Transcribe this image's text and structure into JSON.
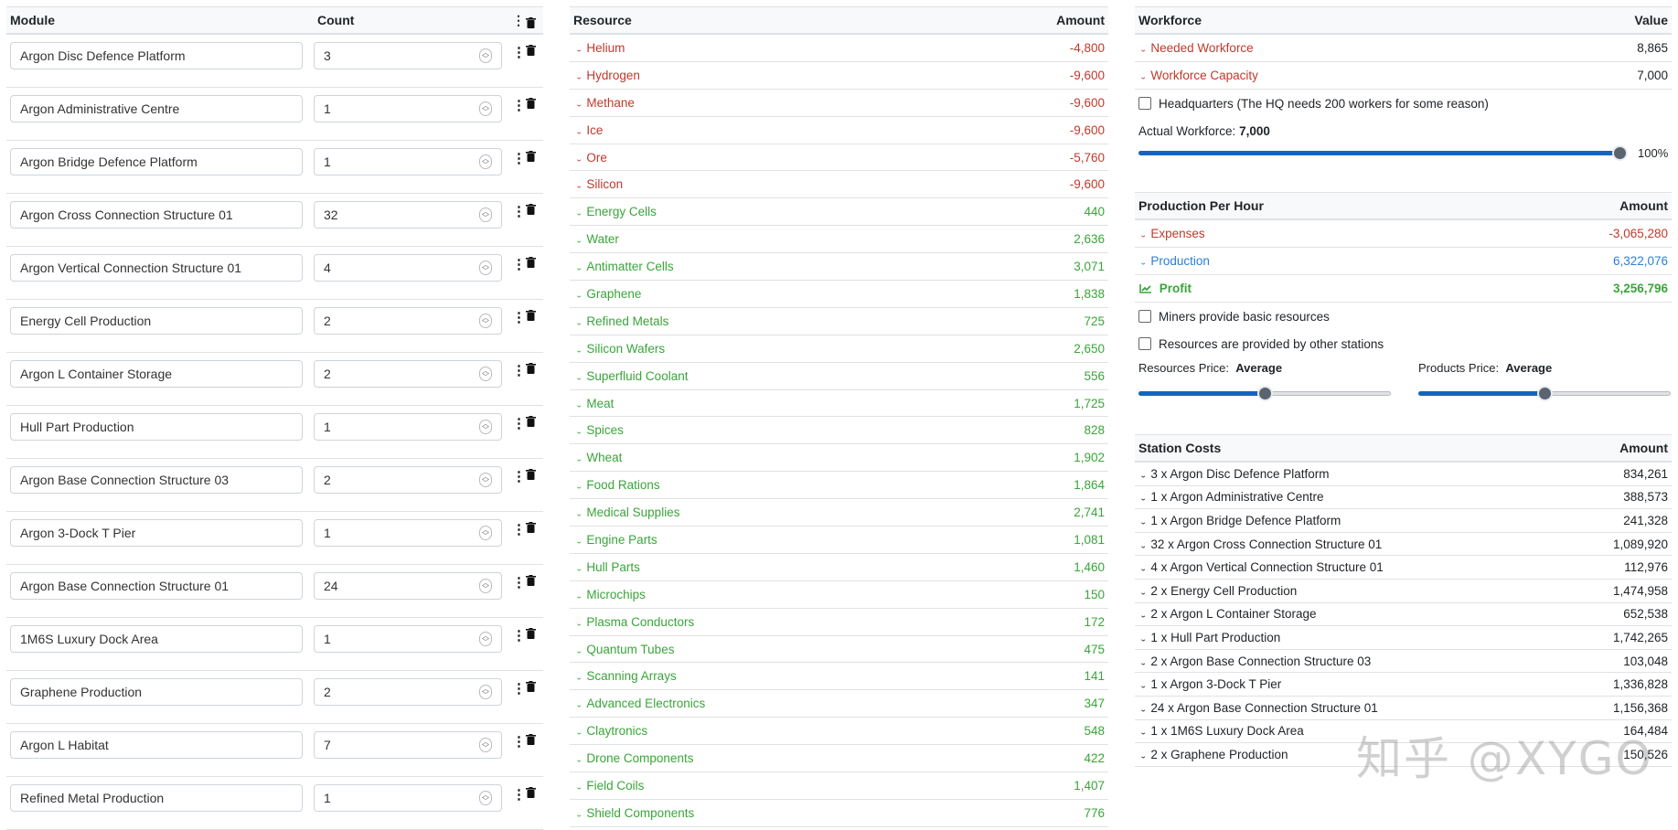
{
  "colors": {
    "negative": "#c0392b",
    "positive": "#3aa53a",
    "production": "#2a7fd4",
    "slider": "#1565c0"
  },
  "modules": {
    "header_module": "Module",
    "header_count": "Count",
    "rows": [
      {
        "name": "Argon Disc Defence Platform",
        "count": "3"
      },
      {
        "name": "Argon Administrative Centre",
        "count": "1"
      },
      {
        "name": "Argon Bridge Defence Platform",
        "count": "1"
      },
      {
        "name": "Argon Cross Connection Structure 01",
        "count": "32"
      },
      {
        "name": "Argon Vertical Connection Structure 01",
        "count": "4"
      },
      {
        "name": "Energy Cell Production",
        "count": "2"
      },
      {
        "name": "Argon L Container Storage",
        "count": "2"
      },
      {
        "name": "Hull Part Production",
        "count": "1"
      },
      {
        "name": "Argon Base Connection Structure 03",
        "count": "2"
      },
      {
        "name": "Argon 3-Dock T Pier",
        "count": "1"
      },
      {
        "name": "Argon Base Connection Structure 01",
        "count": "24"
      },
      {
        "name": "1M6S Luxury Dock Area",
        "count": "1"
      },
      {
        "name": "Graphene Production",
        "count": "2"
      },
      {
        "name": "Argon L Habitat",
        "count": "7"
      },
      {
        "name": "Refined Metal Production",
        "count": "1"
      }
    ]
  },
  "resources": {
    "header_resource": "Resource",
    "header_amount": "Amount",
    "rows": [
      {
        "name": "Helium",
        "amount": "-4,800",
        "kind": "neg"
      },
      {
        "name": "Hydrogen",
        "amount": "-9,600",
        "kind": "neg"
      },
      {
        "name": "Methane",
        "amount": "-9,600",
        "kind": "neg"
      },
      {
        "name": "Ice",
        "amount": "-9,600",
        "kind": "neg"
      },
      {
        "name": "Ore",
        "amount": "-5,760",
        "kind": "neg"
      },
      {
        "name": "Silicon",
        "amount": "-9,600",
        "kind": "neg"
      },
      {
        "name": "Energy Cells",
        "amount": "440",
        "kind": "pos"
      },
      {
        "name": "Water",
        "amount": "2,636",
        "kind": "pos"
      },
      {
        "name": "Antimatter Cells",
        "amount": "3,071",
        "kind": "pos"
      },
      {
        "name": "Graphene",
        "amount": "1,838",
        "kind": "pos"
      },
      {
        "name": "Refined Metals",
        "amount": "725",
        "kind": "pos"
      },
      {
        "name": "Silicon Wafers",
        "amount": "2,650",
        "kind": "pos"
      },
      {
        "name": "Superfluid Coolant",
        "amount": "556",
        "kind": "pos"
      },
      {
        "name": "Meat",
        "amount": "1,725",
        "kind": "pos"
      },
      {
        "name": "Spices",
        "amount": "828",
        "kind": "pos"
      },
      {
        "name": "Wheat",
        "amount": "1,902",
        "kind": "pos"
      },
      {
        "name": "Food Rations",
        "amount": "1,864",
        "kind": "pos"
      },
      {
        "name": "Medical Supplies",
        "amount": "2,741",
        "kind": "pos"
      },
      {
        "name": "Engine Parts",
        "amount": "1,081",
        "kind": "pos"
      },
      {
        "name": "Hull Parts",
        "amount": "1,460",
        "kind": "pos"
      },
      {
        "name": "Microchips",
        "amount": "150",
        "kind": "pos"
      },
      {
        "name": "Plasma Conductors",
        "amount": "172",
        "kind": "pos"
      },
      {
        "name": "Quantum Tubes",
        "amount": "475",
        "kind": "pos"
      },
      {
        "name": "Scanning Arrays",
        "amount": "141",
        "kind": "pos"
      },
      {
        "name": "Advanced Electronics",
        "amount": "347",
        "kind": "pos"
      },
      {
        "name": "Claytronics",
        "amount": "548",
        "kind": "pos"
      },
      {
        "name": "Drone Components",
        "amount": "422",
        "kind": "pos"
      },
      {
        "name": "Field Coils",
        "amount": "1,407",
        "kind": "pos"
      },
      {
        "name": "Shield Components",
        "amount": "776",
        "kind": "pos"
      }
    ]
  },
  "workforce": {
    "header_label": "Workforce",
    "header_value": "Value",
    "needed_label": "Needed Workforce",
    "needed_value": "8,865",
    "capacity_label": "Workforce Capacity",
    "capacity_value": "7,000",
    "hq_label": "Headquarters (The HQ needs 200 workers for some reason)",
    "actual_label": "Actual Workforce:",
    "actual_value": "7,000",
    "slider_percent_label": "100%",
    "slider_fraction": 1.0
  },
  "production": {
    "header_label": "Production Per Hour",
    "header_value": "Amount",
    "expenses_label": "Expenses",
    "expenses_value": "-3,065,280",
    "production_label": "Production",
    "production_value": "6,322,076",
    "profit_label": "Profit",
    "profit_value": "3,256,796",
    "miners_label": "Miners provide basic resources",
    "other_stations_label": "Resources are provided by other stations",
    "resources_price_label": "Resources Price:",
    "resources_price_value": "Average",
    "products_price_label": "Products Price:",
    "products_price_value": "Average",
    "resources_price_fraction": 0.5,
    "products_price_fraction": 0.5
  },
  "station_costs": {
    "header_label": "Station Costs",
    "header_value": "Amount",
    "rows": [
      {
        "label": "3 x Argon Disc Defence Platform",
        "amount": "834,261"
      },
      {
        "label": "1 x Argon Administrative Centre",
        "amount": "388,573"
      },
      {
        "label": "1 x Argon Bridge Defence Platform",
        "amount": "241,328"
      },
      {
        "label": "32 x Argon Cross Connection Structure 01",
        "amount": "1,089,920"
      },
      {
        "label": "4 x Argon Vertical Connection Structure 01",
        "amount": "112,976"
      },
      {
        "label": "2 x Energy Cell Production",
        "amount": "1,474,958"
      },
      {
        "label": "2 x Argon L Container Storage",
        "amount": "652,538"
      },
      {
        "label": "1 x Hull Part Production",
        "amount": "1,742,265"
      },
      {
        "label": "2 x Argon Base Connection Structure 03",
        "amount": "103,048"
      },
      {
        "label": "1 x Argon 3-Dock T Pier",
        "amount": "1,336,828"
      },
      {
        "label": "24 x Argon Base Connection Structure 01",
        "amount": "1,156,368"
      },
      {
        "label": "1 x 1M6S Luxury Dock Area",
        "amount": "164,484"
      },
      {
        "label": "2 x Graphene Production",
        "amount": "150,526"
      }
    ]
  },
  "watermark": "知乎 @XYGO"
}
